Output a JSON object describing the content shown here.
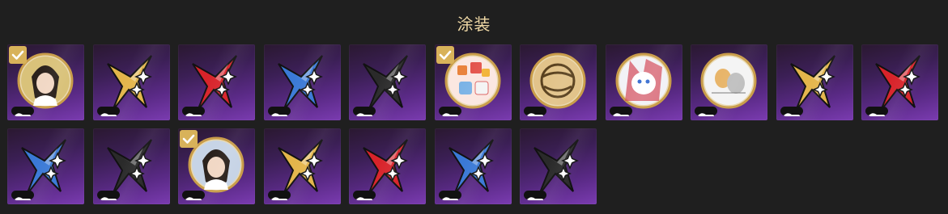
{
  "title": "涂装",
  "colors": {
    "gold": "#e3b54a",
    "red": "#d8232a",
    "blue": "#3a79d6",
    "black": "#2a2a2a",
    "check": "#d8b25a"
  },
  "skins": [
    {
      "kind": "portrait",
      "variant": "girl-dark-hair",
      "selected": true
    },
    {
      "kind": "star",
      "color": "gold",
      "selected": false
    },
    {
      "kind": "star",
      "color": "red",
      "selected": false
    },
    {
      "kind": "star",
      "color": "blue",
      "selected": false
    },
    {
      "kind": "star",
      "color": "black",
      "selected": false
    },
    {
      "kind": "portrait",
      "variant": "cartoon-group",
      "selected": true
    },
    {
      "kind": "portrait",
      "variant": "gold-emblem",
      "selected": false
    },
    {
      "kind": "portrait",
      "variant": "white-creature",
      "selected": false
    },
    {
      "kind": "portrait",
      "variant": "comic-panels",
      "selected": false
    },
    {
      "kind": "star",
      "color": "gold",
      "selected": false
    },
    {
      "kind": "star",
      "color": "red",
      "selected": false
    },
    {
      "kind": "star",
      "color": "blue",
      "selected": false
    },
    {
      "kind": "star",
      "color": "black",
      "selected": false
    },
    {
      "kind": "portrait",
      "variant": "boy-dark-hair",
      "selected": true
    },
    {
      "kind": "star",
      "color": "gold",
      "selected": false
    },
    {
      "kind": "star",
      "color": "red",
      "selected": false
    },
    {
      "kind": "star",
      "color": "blue",
      "selected": false
    },
    {
      "kind": "star",
      "color": "black",
      "selected": false
    }
  ]
}
